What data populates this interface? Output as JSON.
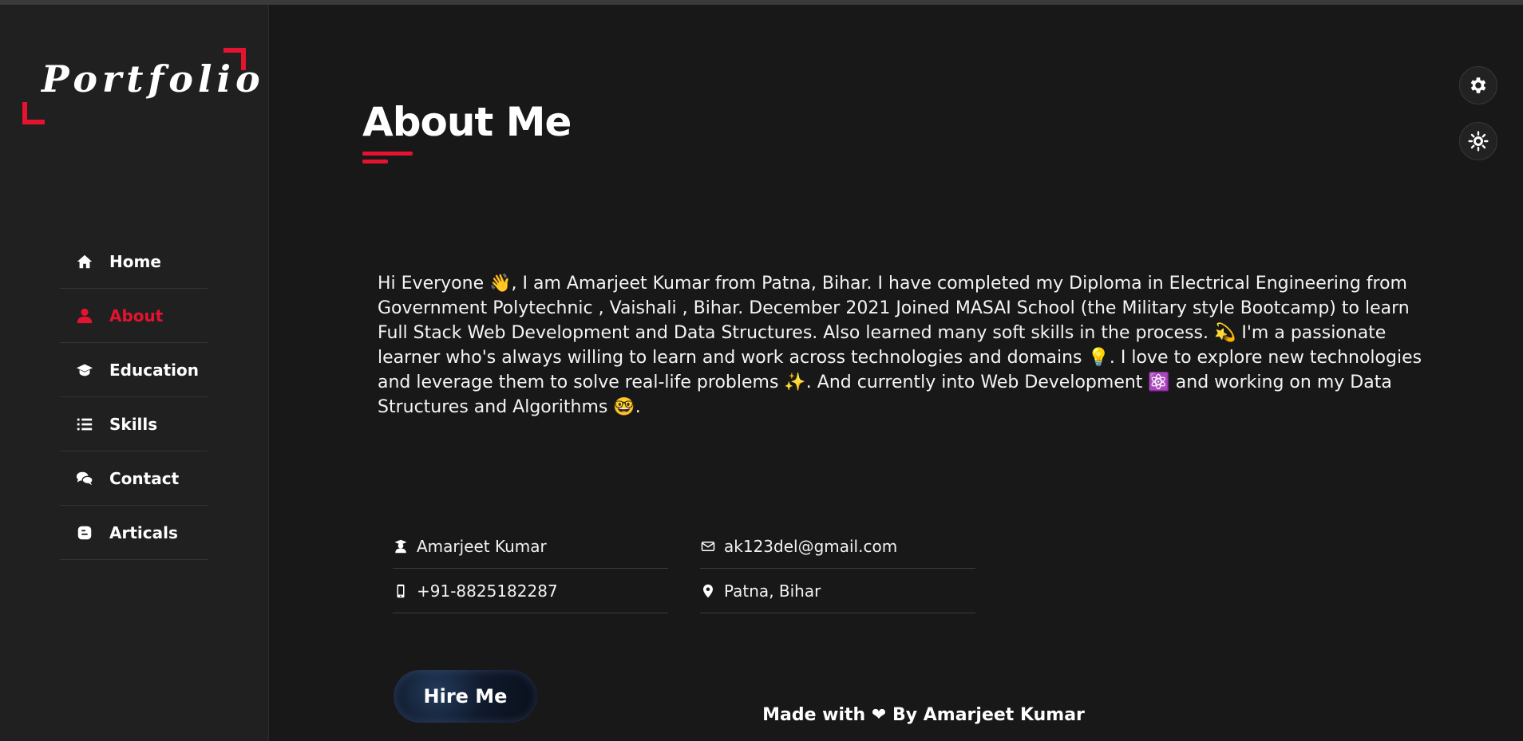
{
  "logo": {
    "text": "Portfolio"
  },
  "sidebar": {
    "items": [
      {
        "label": "Home",
        "icon": "home-icon",
        "active": false
      },
      {
        "label": "About",
        "icon": "user-icon",
        "active": true
      },
      {
        "label": "Education",
        "icon": "graduation-cap-icon",
        "active": false
      },
      {
        "label": "Skills",
        "icon": "list-icon",
        "active": false
      },
      {
        "label": "Contact",
        "icon": "comments-icon",
        "active": false
      },
      {
        "label": "Articals",
        "icon": "blog-icon",
        "active": false
      }
    ]
  },
  "main": {
    "title": "About Me",
    "about_text": "Hi Everyone 👋, I am Amarjeet Kumar from Patna, Bihar. I have completed my Diploma in Electrical Engineering from Government Polytechnic , Vaishali , Bihar. December 2021 Joined MASAI School (the Military style Bootcamp) to learn Full Stack Web Development and Data Structures. Also learned many soft skills in the process. 💫 I'm a passionate learner who's always willing to learn and work across technologies and domains 💡. I love to explore new technologies and leverage them to solve real-life problems ✨. And currently into Web Development ⚛️ and working on my Data Structures and Algorithms 🤓.",
    "info": {
      "name": "Amarjeet Kumar",
      "email": "ak123del@gmail.com",
      "phone": "+91-8825182287",
      "location": "Patna, Bihar"
    },
    "hire_button": "Hire Me",
    "footer": {
      "prefix": "Made with",
      "suffix": "By Amarjeet Kumar"
    }
  },
  "controls": {
    "settings_icon": "gear-icon",
    "theme_icon": "sun-icon"
  },
  "colors": {
    "accent": "#e4132f",
    "background": "#181818",
    "sidebar": "#202020"
  }
}
